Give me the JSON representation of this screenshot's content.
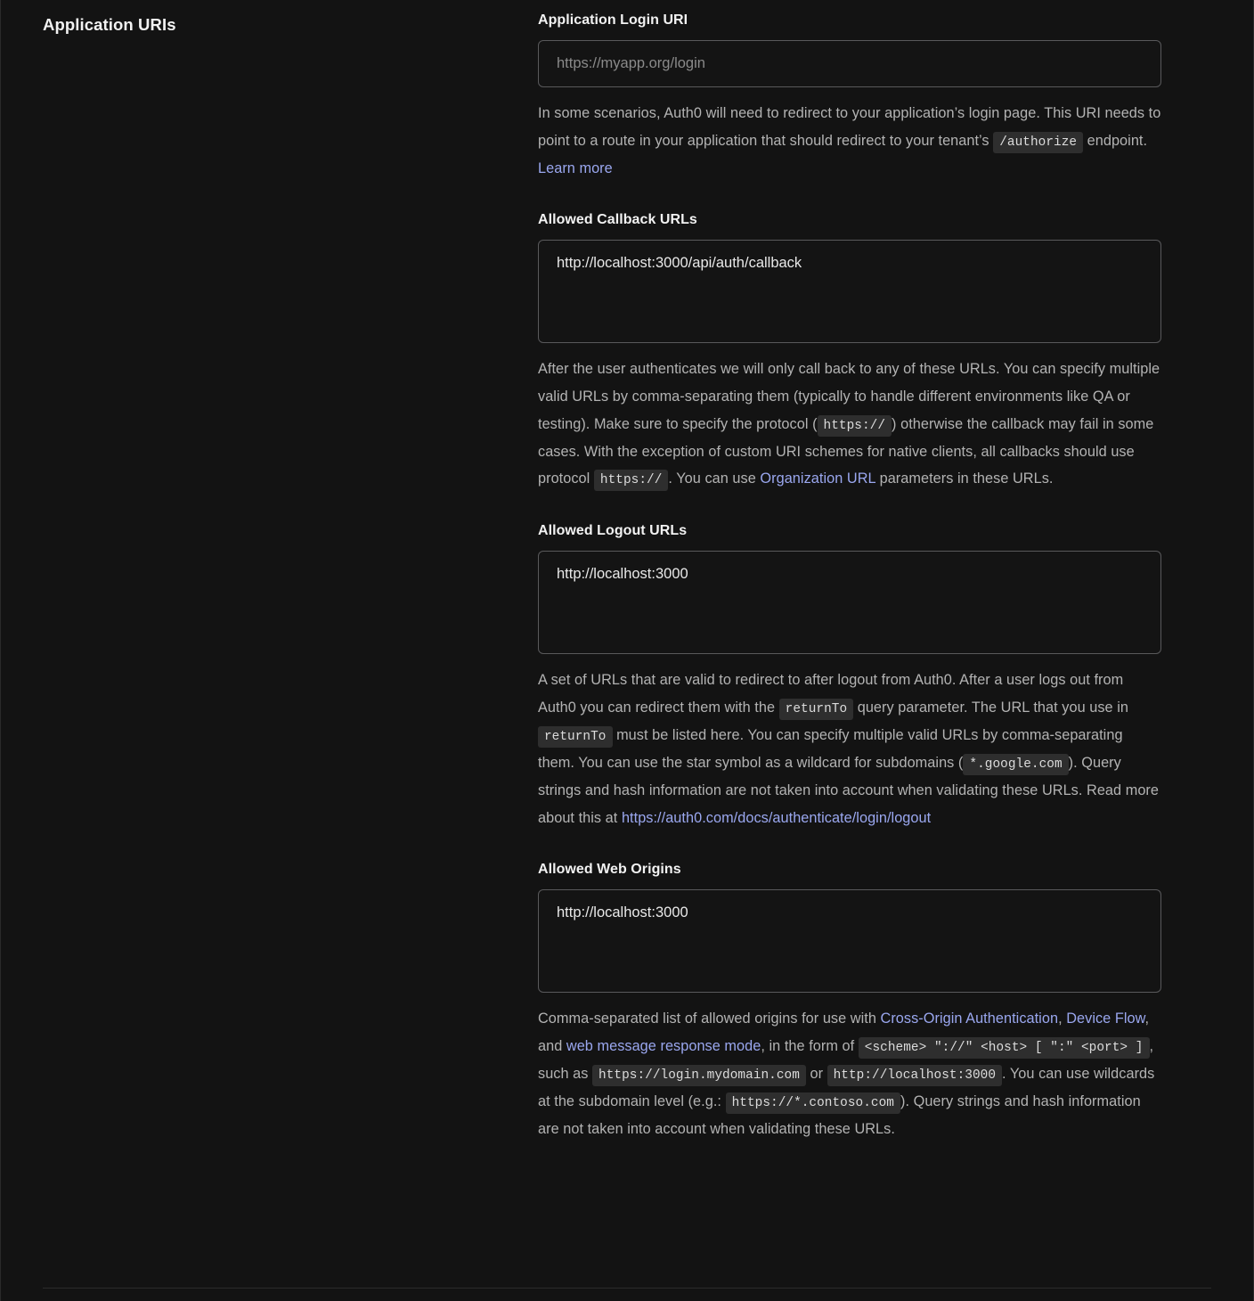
{
  "section": {
    "title": "Application URIs"
  },
  "fields": {
    "login_uri": {
      "label": "Application Login URI",
      "placeholder": "https://myapp.org/login",
      "value": "",
      "help": {
        "p1": "In some scenarios, Auth0 will need to redirect to your application’s login page. This URI needs to point to a route in your application that should redirect to your tenant’s ",
        "code1": "/authorize",
        "p2": " endpoint. ",
        "link1": "Learn more"
      }
    },
    "callback_urls": {
      "label": "Allowed Callback URLs",
      "value": "http://localhost:3000/api/auth/callback",
      "help": {
        "p1": "After the user authenticates we will only call back to any of these URLs. You can specify multiple valid URLs by comma-separating them (typically to handle different environments like QA or testing). Make sure to specify the protocol (",
        "code1": "https://",
        "p2": ") otherwise the callback may fail in some cases. With the exception of custom URI schemes for native clients, all callbacks should use protocol ",
        "code2": "https://",
        "p3": ". You can use ",
        "link1": "Organization URL",
        "p4": " parameters in these URLs."
      }
    },
    "logout_urls": {
      "label": "Allowed Logout URLs",
      "value": "http://localhost:3000",
      "help": {
        "p1": "A set of URLs that are valid to redirect to after logout from Auth0. After a user logs out from Auth0 you can redirect them with the ",
        "code1": "returnTo",
        "p2": " query parameter. The URL that you use in ",
        "code2": "returnTo",
        "p3": " must be listed here. You can specify multiple valid URLs by comma-separating them. You can use the star symbol as a wildcard for subdomains (",
        "code3": "*.google.com",
        "p4": "). Query strings and hash information are not taken into account when validating these URLs. Read more about this at ",
        "link1": "https://auth0.com/docs/authenticate/login/logout"
      }
    },
    "web_origins": {
      "label": "Allowed Web Origins",
      "value": "http://localhost:3000",
      "help": {
        "p1": "Comma-separated list of allowed origins for use with ",
        "link1": "Cross-Origin Authentication",
        "p2": ", ",
        "link2": "Device Flow",
        "p3": ", and ",
        "link3": "web message response mode",
        "p4": ", in the form of ",
        "code1": "<scheme> \"://\" <host> [ \":\" <port> ]",
        "p5": ", such as ",
        "code2": "https://login.mydomain.com",
        "p6": " or ",
        "code3": "http://localhost:3000",
        "p7": ". You can use wildcards at the subdomain level (e.g.: ",
        "code4": "https://*.contoso.com",
        "p8": "). Query strings and hash information are not taken into account when validating these URLs."
      }
    }
  },
  "colors": {
    "background": "#131313",
    "link": "#9aa7ef",
    "border": "#59595b",
    "chip_background": "#2e2e2e",
    "help_text": "#b3b3b3"
  }
}
